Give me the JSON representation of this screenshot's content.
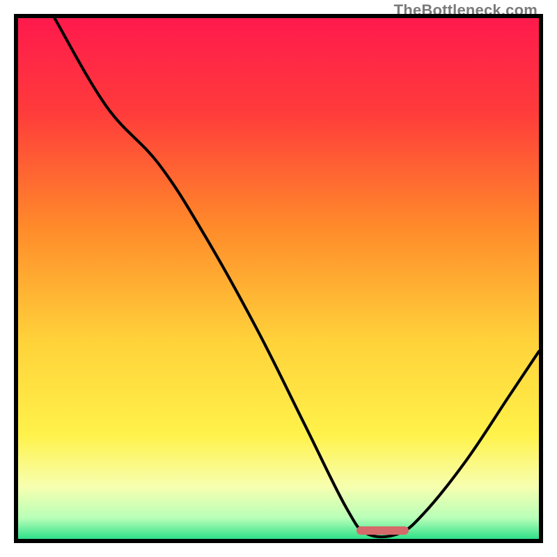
{
  "watermark": "TheBottleneck.com",
  "colors": {
    "border": "#000000",
    "marker": "#d46a6a",
    "gradient_stops": [
      {
        "pos": 0.0,
        "color": "#ff1a4d"
      },
      {
        "pos": 0.18,
        "color": "#ff3b3b"
      },
      {
        "pos": 0.4,
        "color": "#ff8a2a"
      },
      {
        "pos": 0.62,
        "color": "#ffd23a"
      },
      {
        "pos": 0.8,
        "color": "#fff24a"
      },
      {
        "pos": 0.9,
        "color": "#f7ffb0"
      },
      {
        "pos": 0.96,
        "color": "#b8ffb8"
      },
      {
        "pos": 1.0,
        "color": "#2fe08a"
      }
    ]
  },
  "chart_data": {
    "type": "line",
    "title": "",
    "xlabel": "",
    "ylabel": "",
    "xlim": [
      0,
      100
    ],
    "ylim": [
      0,
      100
    ],
    "note": "Single unlabeled curve over a red-to-green vertical gradient; minimum reaches y≈0 near x≈70; a short horizontal marker sits at the curve's minimum.",
    "series": [
      {
        "name": "curve",
        "points": [
          {
            "x": 7,
            "y": 100
          },
          {
            "x": 17,
            "y": 83
          },
          {
            "x": 27,
            "y": 72
          },
          {
            "x": 36,
            "y": 58
          },
          {
            "x": 46,
            "y": 40
          },
          {
            "x": 55,
            "y": 22
          },
          {
            "x": 63,
            "y": 6
          },
          {
            "x": 67,
            "y": 1
          },
          {
            "x": 73,
            "y": 1
          },
          {
            "x": 78,
            "y": 5
          },
          {
            "x": 86,
            "y": 15
          },
          {
            "x": 94,
            "y": 27
          },
          {
            "x": 100,
            "y": 36
          }
        ]
      }
    ],
    "marker": {
      "x_start": 65,
      "x_end": 75,
      "y": 0.8
    }
  }
}
